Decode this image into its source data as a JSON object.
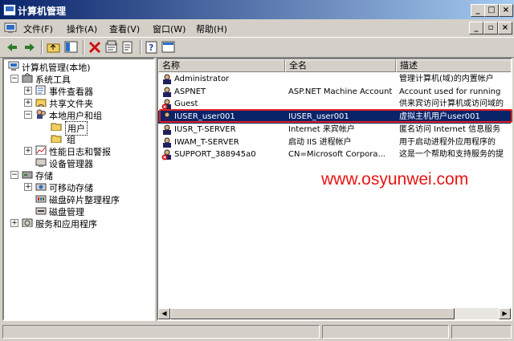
{
  "window": {
    "title": "计算机管理"
  },
  "menu": [
    "文件(F)",
    "操作(A)",
    "查看(V)",
    "窗口(W)",
    "帮助(H)"
  ],
  "tree": {
    "root": "计算机管理(本地)",
    "system_tools": "系统工具",
    "event_viewer": "事件查看器",
    "shared_folders": "共享文件夹",
    "local_users_groups": "本地用户和组",
    "users": "用户",
    "groups": "组",
    "perf_logs": "性能日志和警报",
    "device_manager": "设备管理器",
    "storage": "存储",
    "removable_storage": "可移动存储",
    "disk_defrag": "磁盘碎片整理程序",
    "disk_management": "磁盘管理",
    "services_apps": "服务和应用程序"
  },
  "list": {
    "headers": [
      "名称",
      "全名",
      "描述"
    ],
    "rows": [
      {
        "name": "Administrator",
        "fullname": "",
        "desc": "管理计算机(域)的内置帐户",
        "disabled": false,
        "selected": false
      },
      {
        "name": "ASPNET",
        "fullname": "ASP.NET Machine Account",
        "desc": "Account used for running",
        "disabled": false,
        "selected": false
      },
      {
        "name": "Guest",
        "fullname": "",
        "desc": "供来宾访问计算机或访问域的",
        "disabled": true,
        "selected": false
      },
      {
        "name": "IUSER_user001",
        "fullname": "IUSER_user001",
        "desc": "虚拟主机用户user001",
        "disabled": false,
        "selected": true
      },
      {
        "name": "IUSR_T-SERVER",
        "fullname": "Internet 来宾帐户",
        "desc": "匿名访问 Internet 信息服务",
        "disabled": false,
        "selected": false
      },
      {
        "name": "IWAM_T-SERVER",
        "fullname": "启动 IIS 进程帐户",
        "desc": "用于启动进程外应用程序的",
        "disabled": false,
        "selected": false
      },
      {
        "name": "SUPPORT_388945a0",
        "fullname": "CN=Microsoft Corpora...",
        "desc": "这是一个帮助和支持服务的提",
        "disabled": true,
        "selected": false
      }
    ]
  },
  "watermark": "www.osyunwei.com",
  "colors": {
    "titlebar": "#0a246a",
    "selection": "#0a246a",
    "highlight_box": "#e02020",
    "watermark": "#e81414"
  }
}
